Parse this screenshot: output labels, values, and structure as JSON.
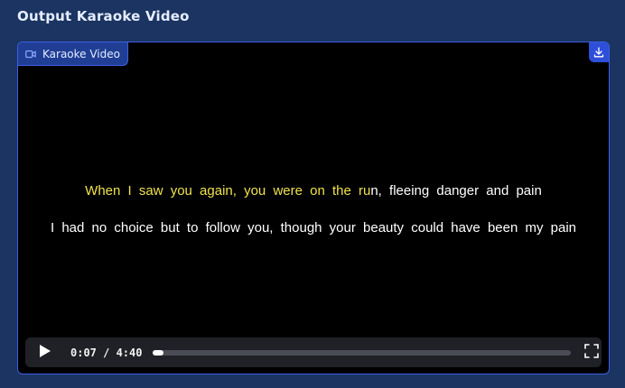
{
  "section": {
    "title": "Output Karaoke Video"
  },
  "video": {
    "label": "Karaoke Video",
    "lyrics": [
      {
        "sung": "When I saw you again, you were on the ru",
        "unsung": "n, fleeing danger and pain"
      },
      {
        "sung": "",
        "unsung": "I had no choice but to follow you, though your beauty could have been my pain"
      }
    ],
    "player": {
      "time_display": "0:07 / 4:40",
      "progress_fraction": 0.025
    }
  },
  "icons": {
    "video_label": "video-camera-icon",
    "download": "download-icon",
    "play": "play-icon",
    "fullscreen": "fullscreen-icon"
  },
  "colors": {
    "sung_lyric": "#f0e24c",
    "unsung_lyric": "#ffffff",
    "accent": "#3d5fe6"
  }
}
